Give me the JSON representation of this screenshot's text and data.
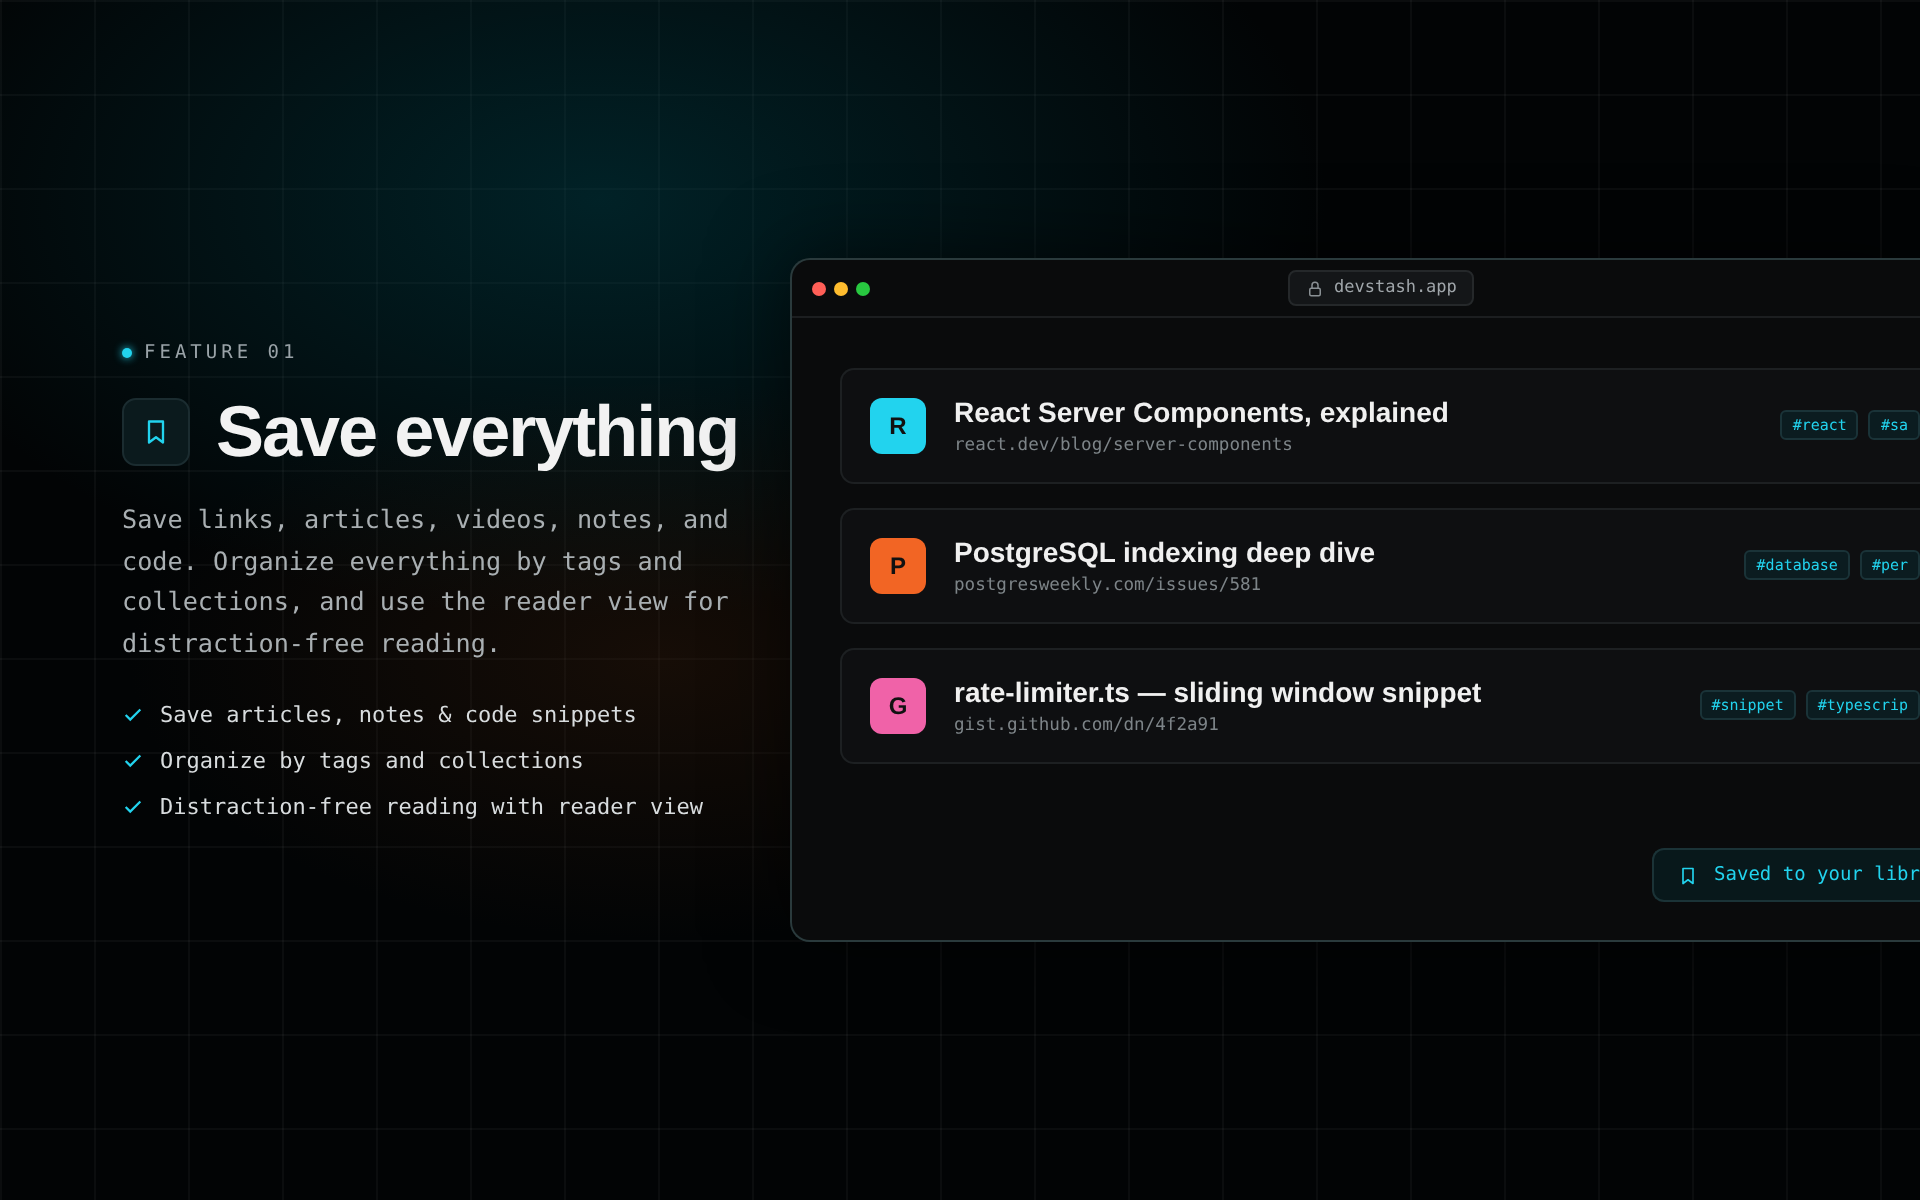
{
  "feature": {
    "eyebrow": "FEATURE 01",
    "title": "Save everything",
    "description": "Save links, articles, videos, notes, and code. Organize everything by tags and collections, and use the reader view for distraction-free reading.",
    "bullets": [
      "Save articles, notes & code snippets",
      "Organize by tags and collections",
      "Distraction-free reading with reader view"
    ]
  },
  "browser": {
    "url": "devstash.app",
    "items": [
      {
        "letter": "R",
        "color": "#22d3ee",
        "title": "React Server Components, explained",
        "url": "react.dev/blog/server-components",
        "tags": [
          "#react",
          "#sa"
        ]
      },
      {
        "letter": "P",
        "color": "#f26524",
        "title": "PostgreSQL indexing deep dive",
        "url": "postgresweekly.com/issues/581",
        "tags": [
          "#database",
          "#per"
        ]
      },
      {
        "letter": "G",
        "color": "#f062a8",
        "title": "rate-limiter.ts — sliding window snippet",
        "url": "gist.github.com/dn/4f2a91",
        "tags": [
          "#snippet",
          "#typescrip"
        ]
      }
    ],
    "toast": "Saved to your libr"
  }
}
